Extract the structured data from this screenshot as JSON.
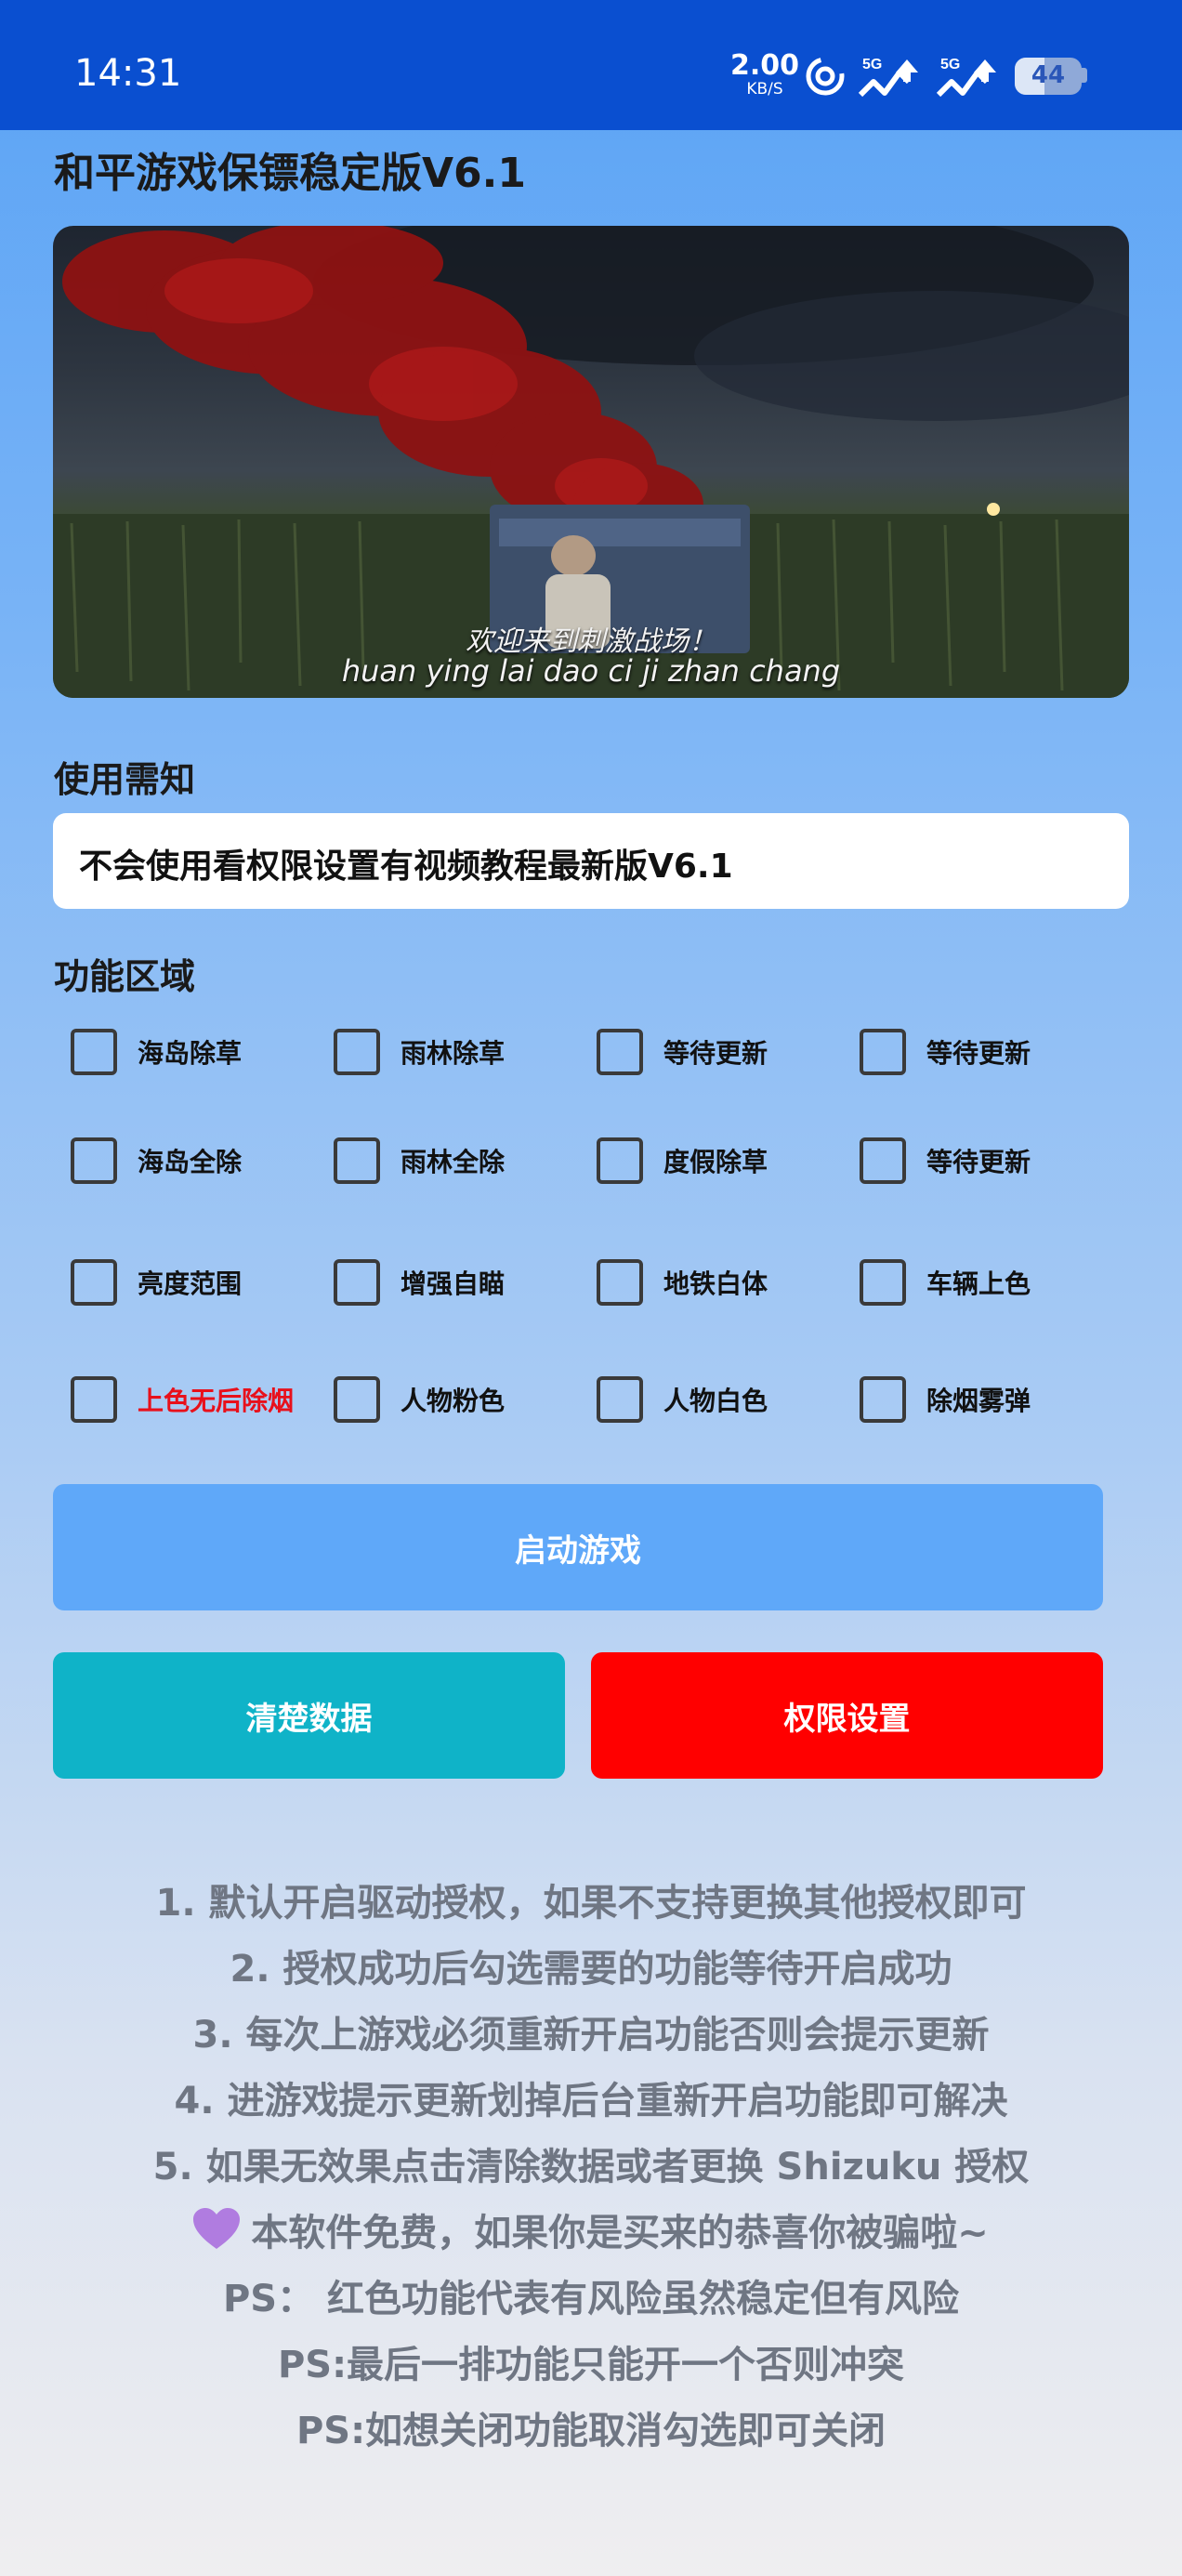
{
  "status_bar": {
    "time": "14:31",
    "speed_value": "2.00",
    "speed_unit": "KB/S",
    "network_1": "5G",
    "network_2": "5G",
    "battery": "44"
  },
  "app": {
    "title": "和平游戏保镖稳定版V6.1"
  },
  "banner": {
    "caption_line1": "欢迎来到刺激战场！",
    "caption_line2": "huan ying lai dao ci ji zhan chang"
  },
  "notice": {
    "section_label": "使用需知",
    "text": "不会使用看权限设置有视频教程最新版V6.1"
  },
  "features": {
    "section_label": "功能区域",
    "items": [
      {
        "label": "海岛除草",
        "checked": false,
        "risk": false
      },
      {
        "label": "雨林除草",
        "checked": false,
        "risk": false
      },
      {
        "label": "等待更新",
        "checked": false,
        "risk": false
      },
      {
        "label": "等待更新",
        "checked": false,
        "risk": false
      },
      {
        "label": "海岛全除",
        "checked": false,
        "risk": false
      },
      {
        "label": "雨林全除",
        "checked": false,
        "risk": false
      },
      {
        "label": "度假除草",
        "checked": false,
        "risk": false
      },
      {
        "label": "等待更新",
        "checked": false,
        "risk": false
      },
      {
        "label": "亮度范围",
        "checked": false,
        "risk": false
      },
      {
        "label": "增强自瞄",
        "checked": false,
        "risk": false
      },
      {
        "label": "地铁白体",
        "checked": false,
        "risk": false
      },
      {
        "label": "车辆上色",
        "checked": false,
        "risk": false
      },
      {
        "label": "上色无后除烟",
        "checked": false,
        "risk": true
      },
      {
        "label": "人物粉色",
        "checked": false,
        "risk": false
      },
      {
        "label": "人物白色",
        "checked": false,
        "risk": false
      },
      {
        "label": "除烟雾弹",
        "checked": false,
        "risk": false
      }
    ]
  },
  "buttons": {
    "start": "启动游戏",
    "clear": "清楚数据",
    "permissions": "权限设置"
  },
  "tips": [
    "1. 默认开启驱动授权，如果不支持更换其他授权即可",
    "2. 授权成功后勾选需要的功能等待开启成功",
    "3. 每次上游戏必须重新开启功能否则会提示更新",
    "4. 进游戏提示更新划掉后台重新开启功能即可解决",
    "5. 如果无效果点击清除数据或者更换 Shizuku 授权",
    "本软件免费，如果你是买来的恭喜你被骗啦~",
    "PS： 红色功能代表有风险虽然稳定但有风险",
    "PS:最后一排功能只能开一个否则冲突",
    "PS:如想关闭功能取消勾选即可关闭"
  ],
  "colors": {
    "status_bar": "#0a4fd0",
    "start_button": "#5fa8f9",
    "clear_button": "#0fb3c8",
    "permission_button": "#ff0000",
    "risk_label": "#e8101b",
    "heart": "#b07ce0"
  }
}
